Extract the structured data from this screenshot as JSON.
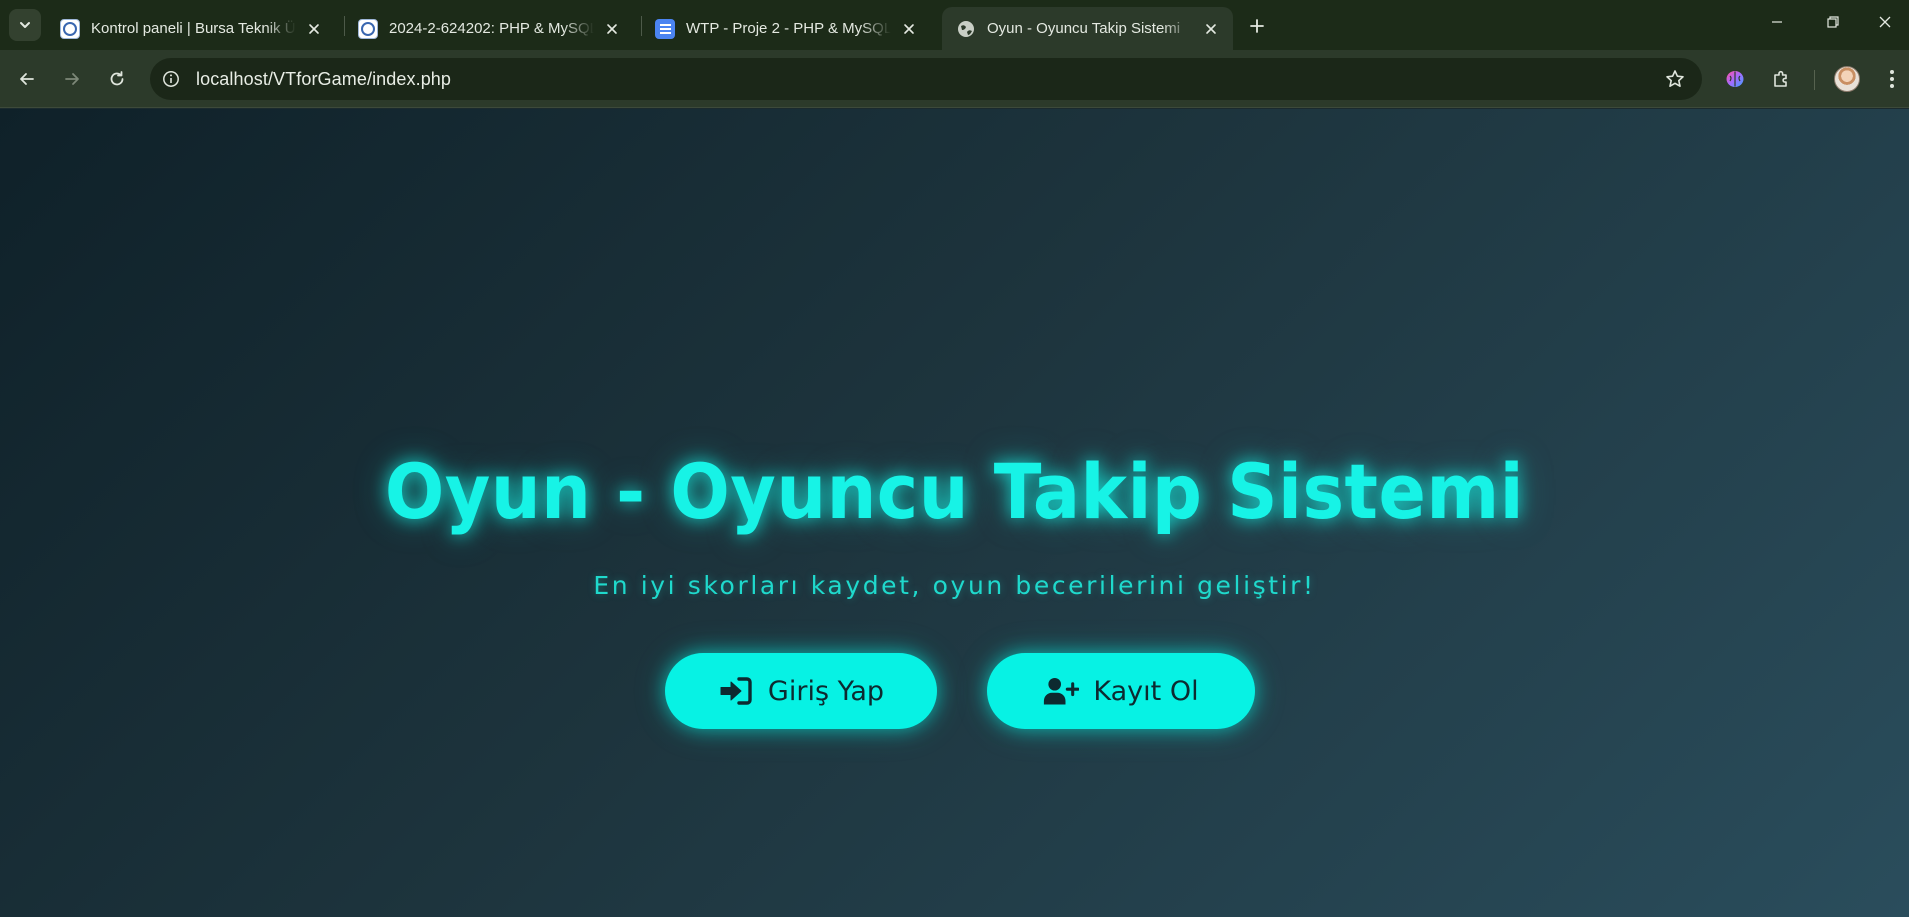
{
  "browser": {
    "tabs": [
      {
        "title": "Kontrol paneli | Bursa Teknik Üni",
        "favicon": "moodle-icon",
        "active": false
      },
      {
        "title": "2024-2-624202: PHP & MySQL",
        "favicon": "moodle-icon",
        "active": false
      },
      {
        "title": "WTP - Proje 2 - PHP & MySQL",
        "favicon": "google-docs-icon",
        "active": false
      },
      {
        "title": "Oyun - Oyuncu Takip Sistemi",
        "favicon": "globe-icon",
        "active": true
      }
    ],
    "url": "localhost/VTforGame/index.php"
  },
  "page": {
    "title": "Oyun - Oyuncu Takip Sistemi",
    "subtitle": "En iyi skorları kaydet, oyun becerilerini geliştir!",
    "buttons": {
      "login": {
        "label": "Giriş Yap",
        "icon": "sign-in-icon"
      },
      "register": {
        "label": "Kayıt Ol",
        "icon": "user-plus-icon"
      }
    }
  },
  "colors": {
    "accent": "#07f2e4",
    "tab_bar": "#1c2b18",
    "toolbar": "#2c3a2a",
    "page_bg_start": "#0f2129",
    "page_bg_end": "#2a4d5c"
  }
}
